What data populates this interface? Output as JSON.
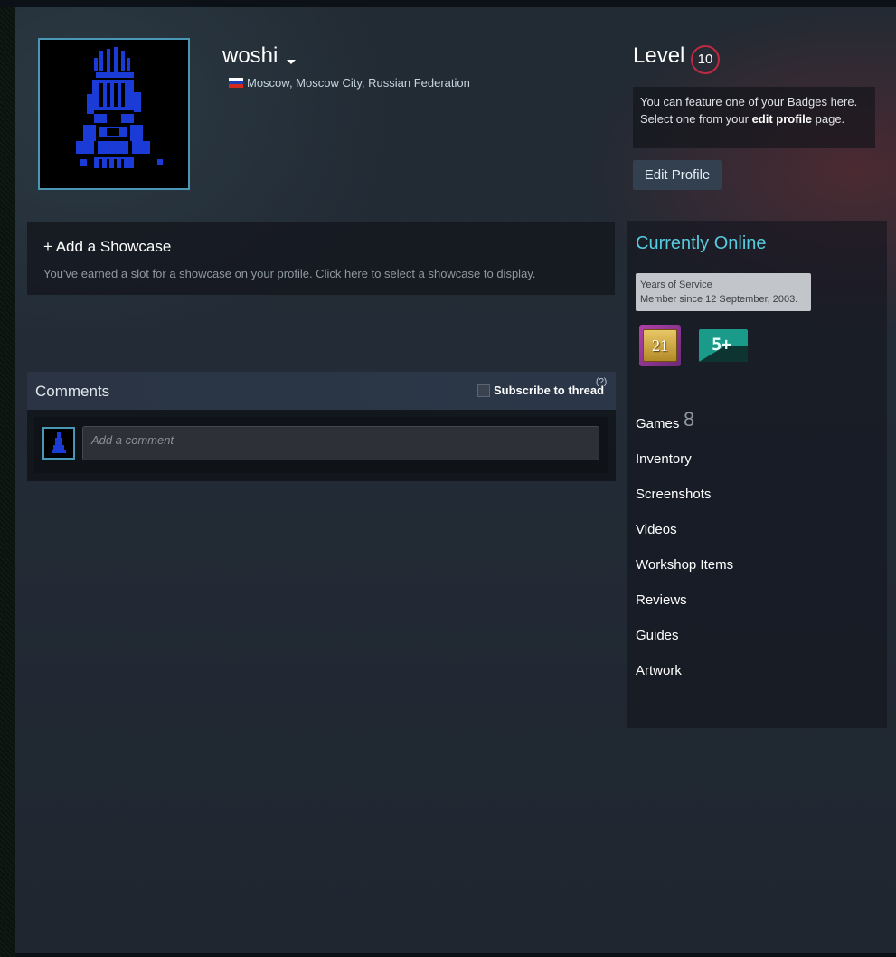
{
  "profile": {
    "persona_name": "woshi",
    "location": "Moscow, Moscow City, Russian Federation",
    "flag_icon": "russia-flag-icon",
    "avatar_icon": "skull-avatar-icon"
  },
  "level": {
    "label": "Level",
    "value": "10",
    "badge_note_line1": "You can feature one of your Badges here.",
    "badge_note_line2_pre": "Select one from your ",
    "badge_note_link": "edit profile",
    "badge_note_line2_post": " page.",
    "edit_profile_label": "Edit Profile"
  },
  "showcase": {
    "title": "+ Add a Showcase",
    "description": "You've earned a slot for a showcase on your profile. Click here to select a showcase to display."
  },
  "comments": {
    "title": "Comments",
    "subscribe_label": "Subscribe to thread",
    "help_label": "(?)",
    "input_placeholder": "Add a comment"
  },
  "sidebar": {
    "status": "Currently Online",
    "tooltip_title": "Years of Service",
    "tooltip_text": "Member since 12 September, 2003.",
    "badge_years": "21",
    "badge_games": "5+",
    "games_label": "Games",
    "games_count": "8",
    "links": [
      "Inventory",
      "Screenshots",
      "Videos",
      "Workshop Items",
      "Reviews",
      "Guides",
      "Artwork"
    ]
  },
  "colors": {
    "accent_online": "#57cbde",
    "level_ring": "#c02942",
    "avatar_border": "#4a97b5"
  }
}
